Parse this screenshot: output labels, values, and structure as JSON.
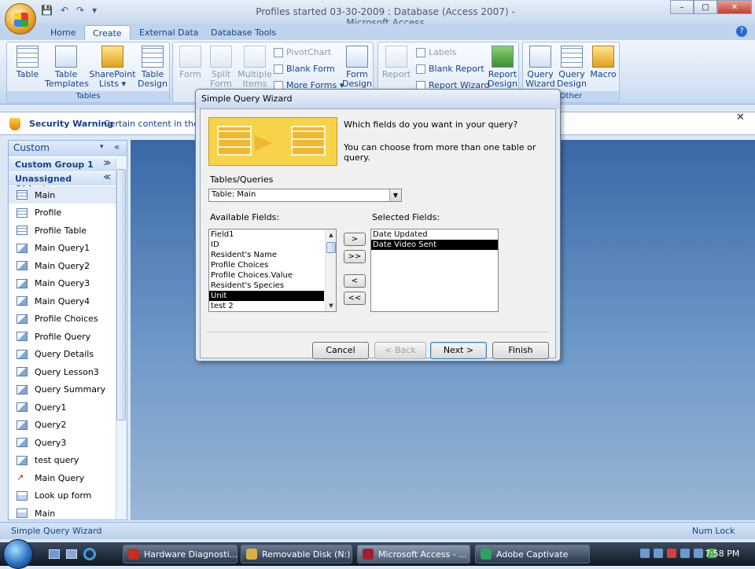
{
  "window": {
    "title": "Profiles started 03-30-2009 : Database (Access 2007) - Microsoft Access",
    "controls": [
      "–",
      "□",
      "✕"
    ]
  },
  "qat": [
    "💾",
    "↶",
    "↷",
    "▾"
  ],
  "tabs": [
    {
      "label": "Home",
      "active": false
    },
    {
      "label": "Create",
      "active": true
    },
    {
      "label": "External Data",
      "active": false
    },
    {
      "label": "Database Tools",
      "active": false
    }
  ],
  "help_glyph": "?",
  "ribbon": {
    "tables": {
      "label": "Tables",
      "buttons": [
        "Table",
        "Table Templates ▾",
        "SharePoint Lists ▾",
        "Table Design"
      ]
    },
    "forms": {
      "buttons": [
        "Form",
        "Split Form",
        "Multiple Items"
      ],
      "small": [
        "PivotChart",
        "Blank Form",
        "More Forms ▾"
      ],
      "design": "Form Design"
    },
    "reports": {
      "buttons": [
        "Report"
      ],
      "small": [
        "Labels",
        "Blank Report",
        "Report Wizard"
      ],
      "design": "Report Design"
    },
    "other": {
      "label": "Other",
      "buttons": [
        "Query Wizard",
        "Query Design",
        "Macro"
      ]
    }
  },
  "security": {
    "title": "Security Warning",
    "message": "Certain content in the d",
    "close": "✕"
  },
  "nav": {
    "header": "Custom",
    "header_chevron": "▾",
    "collapse": "«",
    "groups": [
      {
        "label": "Custom Group 1",
        "toggle": "≫"
      },
      {
        "label": "Unassigned Objects",
        "toggle": "≪"
      }
    ],
    "items": [
      {
        "label": "Main",
        "icon": "table",
        "selected": true
      },
      {
        "label": "Profile",
        "icon": "table"
      },
      {
        "label": "Profile Table",
        "icon": "table"
      },
      {
        "label": "Main Query1",
        "icon": "query"
      },
      {
        "label": "Main Query2",
        "icon": "query"
      },
      {
        "label": "Main Query3",
        "icon": "query"
      },
      {
        "label": "Main Query4",
        "icon": "query"
      },
      {
        "label": "Profile Choices",
        "icon": "query"
      },
      {
        "label": "Profile Query",
        "icon": "query"
      },
      {
        "label": "Query Details",
        "icon": "query"
      },
      {
        "label": "Query Lesson3",
        "icon": "query"
      },
      {
        "label": "Query Summary",
        "icon": "query"
      },
      {
        "label": "Query1",
        "icon": "query"
      },
      {
        "label": "Query2",
        "icon": "query"
      },
      {
        "label": "Query3",
        "icon": "query"
      },
      {
        "label": "test query",
        "icon": "query"
      },
      {
        "label": "Main Query",
        "icon": "macro"
      },
      {
        "label": "Look up form",
        "icon": "form"
      },
      {
        "label": "Main",
        "icon": "form"
      }
    ]
  },
  "dialog": {
    "title": "Simple Query Wizard",
    "prompt1": "Which fields do you want in your query?",
    "prompt2": "You can choose from more than one table or query.",
    "tables_label": "Tables/Queries",
    "table_value": "Table: Main",
    "available_label": "Available Fields:",
    "selected_label": "Selected Fields:",
    "available": [
      "Field1",
      "ID",
      "Resident's Name",
      "Profile Choices",
      "Profile Choices.Value",
      "Resident's Species",
      "Unit",
      "test 2"
    ],
    "available_selected_index": 6,
    "selected": [
      "Date Updated",
      "Date Video Sent"
    ],
    "selected_selected_index": 1,
    "move_buttons": [
      ">",
      ">>",
      "<",
      "<<"
    ],
    "scroll_up": "▲",
    "scroll_down": "▼",
    "buttons": {
      "cancel": "Cancel",
      "back": "< Back",
      "next": "Next >",
      "finish": "Finish"
    }
  },
  "status": {
    "left": "Simple Query Wizard",
    "right": "Num Lock"
  },
  "taskbar": {
    "items": [
      "Hardware Diagnosti...",
      "Removable Disk (N:)",
      "Microsoft Access - ...",
      "Adobe Captivate"
    ],
    "active_index": 2,
    "clock": "7:58 PM"
  },
  "colors": {
    "accent": "#15428b",
    "workspace": "#4a78b4",
    "banner": "#f7d34a"
  }
}
